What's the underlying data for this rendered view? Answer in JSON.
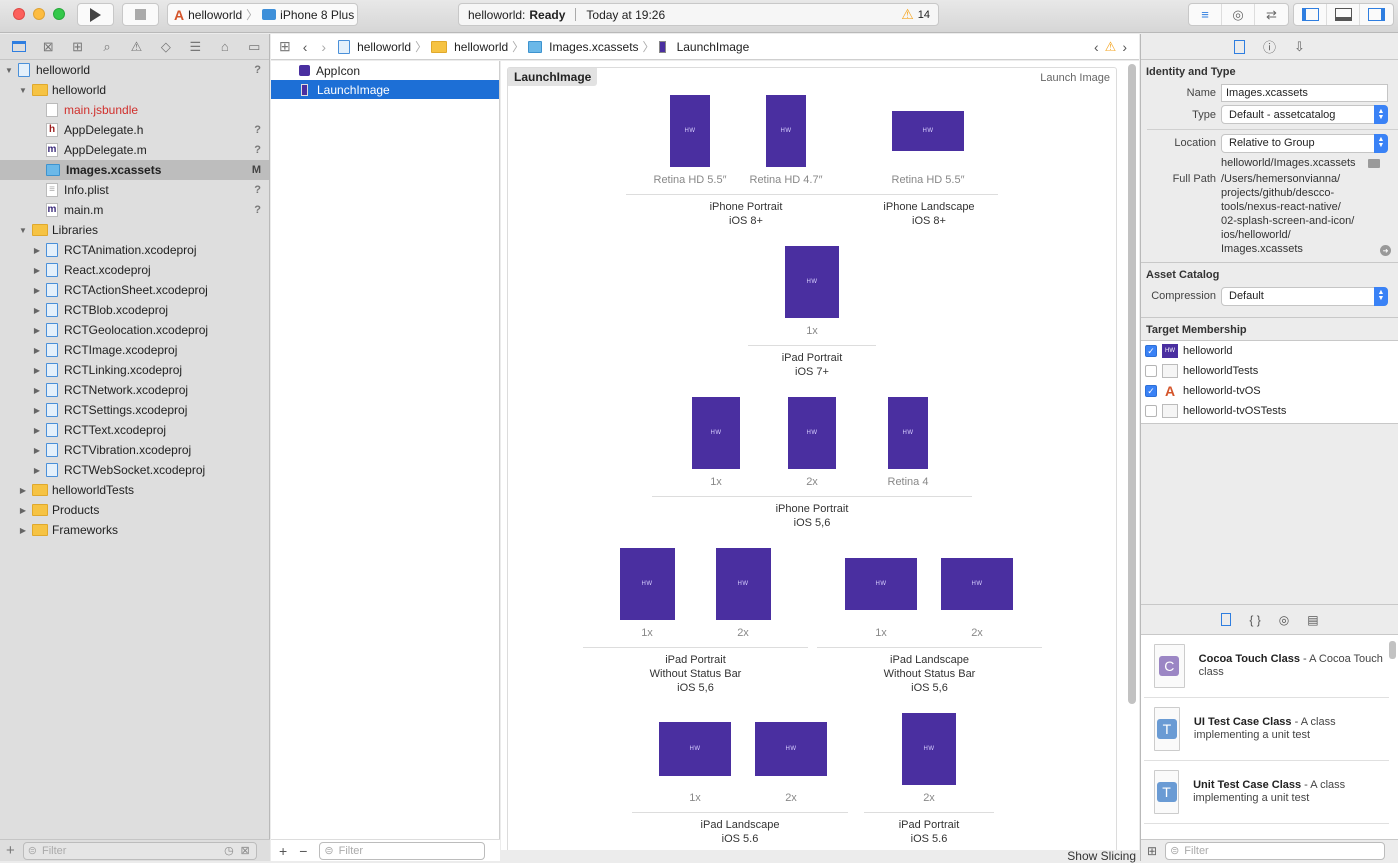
{
  "toolbar": {
    "scheme_target": "helloworld",
    "scheme_device": "iPhone 8 Plus",
    "status_project": "helloworld:",
    "status_state": "Ready",
    "status_time": "Today at 19:26",
    "warning_count": "14"
  },
  "navigator": {
    "tree": [
      {
        "label": "helloworld",
        "level": 0,
        "type": "project",
        "expanded": true,
        "badge": "?"
      },
      {
        "label": "helloworld",
        "level": 1,
        "type": "folder",
        "expanded": true,
        "badge": ""
      },
      {
        "label": "main.jsbundle",
        "level": 2,
        "type": "missing",
        "badge": ""
      },
      {
        "label": "AppDelegate.h",
        "level": 2,
        "type": "h",
        "badge": "?"
      },
      {
        "label": "AppDelegate.m",
        "level": 2,
        "type": "m",
        "badge": "?"
      },
      {
        "label": "Images.xcassets",
        "level": 2,
        "type": "assets",
        "badge": "M",
        "selected": true
      },
      {
        "label": "Info.plist",
        "level": 2,
        "type": "plist",
        "badge": "?"
      },
      {
        "label": "main.m",
        "level": 2,
        "type": "m",
        "badge": "?"
      },
      {
        "label": "Libraries",
        "level": 1,
        "type": "folder",
        "expanded": true,
        "badge": ""
      },
      {
        "label": "RCTAnimation.xcodeproj",
        "level": 2,
        "type": "xcodeproj",
        "badge": ""
      },
      {
        "label": "React.xcodeproj",
        "level": 2,
        "type": "xcodeproj",
        "badge": ""
      },
      {
        "label": "RCTActionSheet.xcodeproj",
        "level": 2,
        "type": "xcodeproj",
        "badge": ""
      },
      {
        "label": "RCTBlob.xcodeproj",
        "level": 2,
        "type": "xcodeproj",
        "badge": ""
      },
      {
        "label": "RCTGeolocation.xcodeproj",
        "level": 2,
        "type": "xcodeproj",
        "badge": ""
      },
      {
        "label": "RCTImage.xcodeproj",
        "level": 2,
        "type": "xcodeproj",
        "badge": ""
      },
      {
        "label": "RCTLinking.xcodeproj",
        "level": 2,
        "type": "xcodeproj",
        "badge": ""
      },
      {
        "label": "RCTNetwork.xcodeproj",
        "level": 2,
        "type": "xcodeproj",
        "badge": ""
      },
      {
        "label": "RCTSettings.xcodeproj",
        "level": 2,
        "type": "xcodeproj",
        "badge": ""
      },
      {
        "label": "RCTText.xcodeproj",
        "level": 2,
        "type": "xcodeproj",
        "badge": ""
      },
      {
        "label": "RCTVibration.xcodeproj",
        "level": 2,
        "type": "xcodeproj",
        "badge": ""
      },
      {
        "label": "RCTWebSocket.xcodeproj",
        "level": 2,
        "type": "xcodeproj",
        "badge": ""
      },
      {
        "label": "helloworldTests",
        "level": 1,
        "type": "folder",
        "expanded": false,
        "badge": ""
      },
      {
        "label": "Products",
        "level": 1,
        "type": "folder",
        "expanded": false,
        "badge": ""
      },
      {
        "label": "Frameworks",
        "level": 1,
        "type": "folder",
        "expanded": false,
        "badge": ""
      }
    ],
    "filter_placeholder": "Filter"
  },
  "jumpbar": {
    "crumbs": [
      "helloworld",
      "helloworld",
      "Images.xcassets",
      "LaunchImage"
    ]
  },
  "asset_list": {
    "items": [
      {
        "label": "AppIcon",
        "selected": false
      },
      {
        "label": "LaunchImage",
        "selected": true
      }
    ],
    "filter_placeholder": "Filter"
  },
  "canvas": {
    "set_name": "LaunchImage",
    "set_type": "Launch Image",
    "slot_text": "HW",
    "groups": [
      {
        "title": [
          "iPhone Portrait",
          "iOS 8+"
        ],
        "slots": [
          "Retina HD 5.5″",
          "Retina HD 4.7″"
        ]
      },
      {
        "title": [
          "iPhone Landscape",
          "iOS 8+"
        ],
        "slots": [
          "Retina HD 5.5″"
        ]
      },
      {
        "title": [
          "iPad Portrait",
          "iOS 7+"
        ],
        "slots": [
          "1x"
        ]
      },
      {
        "title": [
          "iPhone Portrait",
          "iOS 5,6"
        ],
        "slots": [
          "1x",
          "2x",
          "Retina 4"
        ]
      },
      {
        "title": [
          "iPad Portrait",
          "Without Status Bar",
          "iOS 5,6"
        ],
        "slots": [
          "1x",
          "2x"
        ]
      },
      {
        "title": [
          "iPad Landscape",
          "Without Status Bar",
          "iOS 5,6"
        ],
        "slots": [
          "1x",
          "2x"
        ]
      },
      {
        "title": [
          "iPad Landscape",
          "iOS 5.6"
        ],
        "slots": [
          "1x",
          "2x"
        ]
      },
      {
        "title": [
          "iPad Portrait",
          "iOS 5.6"
        ],
        "slots": [
          "2x"
        ]
      }
    ],
    "show_slicing": "Show Slicing"
  },
  "inspector": {
    "identity": {
      "header": "Identity and Type",
      "name_label": "Name",
      "name_value": "Images.xcassets",
      "type_label": "Type",
      "type_value": "Default - assetcatalog",
      "location_label": "Location",
      "location_value": "Relative to Group",
      "relative_path": "helloworld/Images.xcassets",
      "fullpath_label": "Full Path",
      "fullpath_lines": [
        "/Users/hemersonvianna/",
        "projects/github/descco-",
        "tools/nexus-react-native/",
        "02-splash-screen-and-icon/",
        "ios/helloworld/",
        "Images.xcassets"
      ]
    },
    "asset_catalog": {
      "header": "Asset Catalog",
      "compression_label": "Compression",
      "compression_value": "Default"
    },
    "target_membership": {
      "header": "Target Membership",
      "targets": [
        {
          "label": "helloworld",
          "checked": true,
          "icon": "app-icon"
        },
        {
          "label": "helloworldTests",
          "checked": false,
          "icon": "bundle-icon"
        },
        {
          "label": "helloworld-tvOS",
          "checked": true,
          "icon": "xcode-app-icon"
        },
        {
          "label": "helloworld-tvOSTests",
          "checked": false,
          "icon": "bundle-icon"
        }
      ]
    },
    "library": {
      "items": [
        {
          "title": "Cocoa Touch Class",
          "desc": " - A Cocoa Touch class",
          "glyph": "C",
          "color": "#9b86c4"
        },
        {
          "title": "UI Test Case Class",
          "desc": " - A class implementing a unit test",
          "glyph": "T",
          "color": "#6a9bd4"
        },
        {
          "title": "Unit Test Case Class",
          "desc": " - A class implementing a unit test",
          "glyph": "T",
          "color": "#6a9bd4"
        }
      ],
      "filter_placeholder": "Filter"
    }
  },
  "colors": {
    "accent": "#1d6fd6",
    "launch_image_fill": "#4a2fa0",
    "warning": "#f5a623",
    "missing_file": "#d0302d"
  }
}
